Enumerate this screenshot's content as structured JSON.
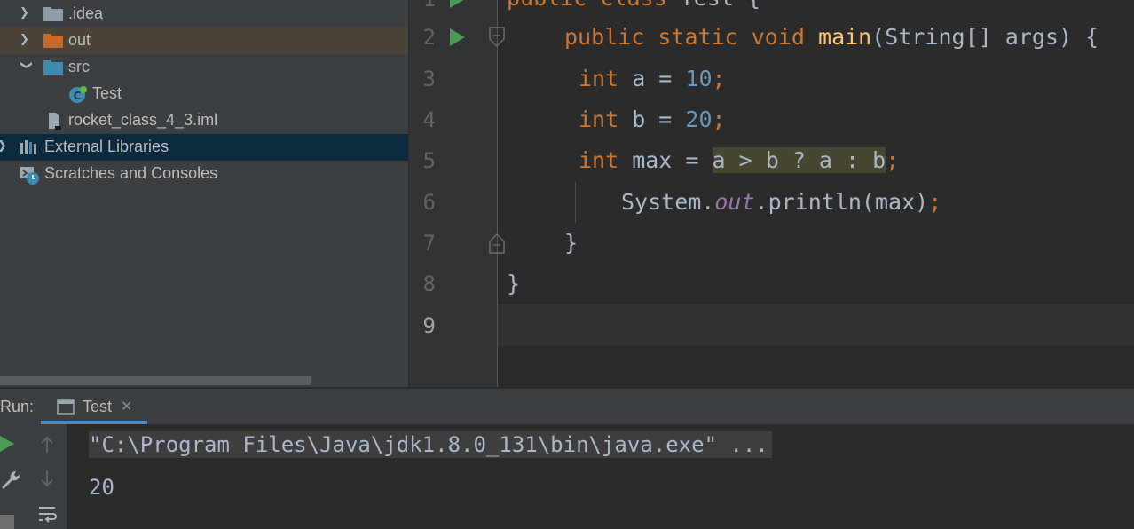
{
  "project_tree": {
    "items": [
      {
        "label": ".idea",
        "type": "folder",
        "expanded": false
      },
      {
        "label": "out",
        "type": "folder",
        "expanded": false
      },
      {
        "label": "src",
        "type": "folder",
        "expanded": true
      },
      {
        "label": "Test",
        "type": "java-class"
      },
      {
        "label": "rocket_class_4_3.iml",
        "type": "iml-file"
      },
      {
        "label": "External Libraries",
        "type": "libraries",
        "selected": true
      },
      {
        "label": "Scratches and Consoles",
        "type": "scratches"
      }
    ]
  },
  "editor": {
    "line_numbers": [
      "2",
      "3",
      "4",
      "5",
      "6",
      "7",
      "8",
      "9"
    ],
    "lines": {
      "l2": {
        "kw1": "public",
        "kw2": "static",
        "kw3": "void",
        "fn": "main",
        "rest": "(String[] args) {"
      },
      "l3": {
        "kw": "int",
        "mid": " a = ",
        "num": "10",
        "end": ";"
      },
      "l4": {
        "kw": "int",
        "mid": " b = ",
        "num": "20",
        "end": ";"
      },
      "l5": {
        "kw": "int",
        "mid": " max = ",
        "tern": "a > b ? a : b",
        "end": ";"
      },
      "l6": {
        "pre": "System.",
        "fld": "out",
        "post": ".println(max)",
        "end": ";"
      },
      "l7": {
        "text": "}"
      },
      "l8": {
        "text": "}"
      }
    }
  },
  "run_panel": {
    "label": "Run:",
    "tab_label": "Test",
    "console": {
      "command": "\"C:\\Program Files\\Java\\jdk1.8.0_131\\bin\\java.exe\" ...",
      "output": "20"
    }
  },
  "colors": {
    "keyword": "#cc7832",
    "function": "#ffc66d",
    "number": "#6897bb",
    "field": "#9876aa",
    "run_green": "#499c54"
  }
}
